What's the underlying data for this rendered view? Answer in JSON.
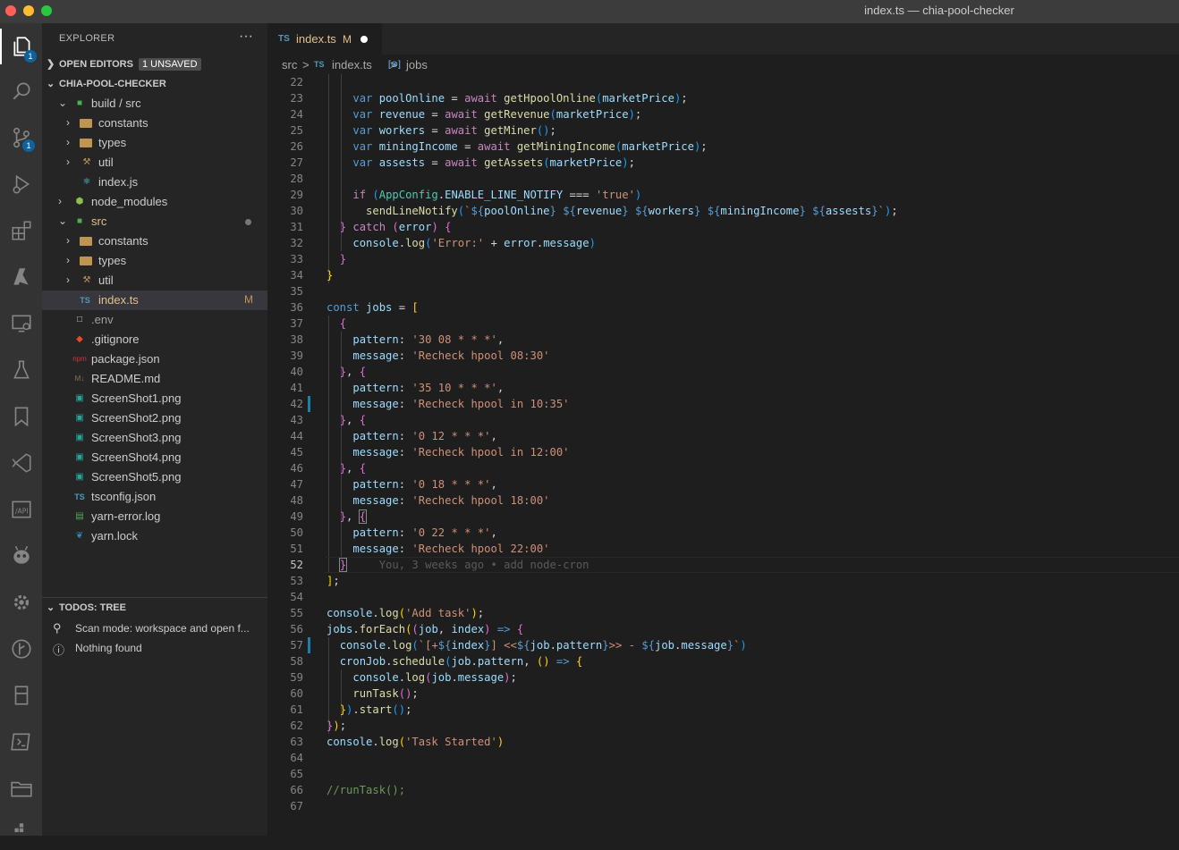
{
  "window": {
    "title": "index.ts — chia-pool-checker"
  },
  "activity": {
    "explorer_badge": "1",
    "scm_badge": "1"
  },
  "sidebar": {
    "title": "EXPLORER",
    "more": "···",
    "open_editors": {
      "label": "OPEN EDITORS",
      "badge": "1 UNSAVED"
    },
    "project": {
      "label": "CHIA-POOL-CHECKER"
    },
    "tree": [
      {
        "name": "build / src",
        "type": "folder-open",
        "depth": 1
      },
      {
        "name": "constants",
        "type": "folder",
        "depth": 2
      },
      {
        "name": "types",
        "type": "folder",
        "depth": 2
      },
      {
        "name": "util",
        "type": "folder",
        "depth": 2
      },
      {
        "name": "index.js",
        "type": "file",
        "depth": 2
      },
      {
        "name": "node_modules",
        "type": "folder",
        "depth": 1
      },
      {
        "name": "src",
        "type": "folder-open",
        "depth": 1
      },
      {
        "name": "constants",
        "type": "folder",
        "depth": 2
      },
      {
        "name": "types",
        "type": "folder",
        "depth": 2
      },
      {
        "name": "util",
        "type": "folder",
        "depth": 2
      },
      {
        "name": "index.ts",
        "type": "file",
        "depth": 2,
        "status": "M"
      },
      {
        "name": ".env",
        "type": "file",
        "depth": 1
      },
      {
        "name": ".gitignore",
        "type": "file",
        "depth": 1
      },
      {
        "name": "package.json",
        "type": "file",
        "depth": 1
      },
      {
        "name": "README.md",
        "type": "file",
        "depth": 1
      },
      {
        "name": "ScreenShot1.png",
        "type": "file",
        "depth": 1
      },
      {
        "name": "ScreenShot2.png",
        "type": "file",
        "depth": 1
      },
      {
        "name": "ScreenShot3.png",
        "type": "file",
        "depth": 1
      },
      {
        "name": "ScreenShot4.png",
        "type": "file",
        "depth": 1
      },
      {
        "name": "ScreenShot5.png",
        "type": "file",
        "depth": 1
      },
      {
        "name": "tsconfig.json",
        "type": "file",
        "depth": 1
      },
      {
        "name": "yarn-error.log",
        "type": "file",
        "depth": 1
      },
      {
        "name": "yarn.lock",
        "type": "file",
        "depth": 1
      }
    ],
    "todos": {
      "label": "TODOS: TREE",
      "scan": "Scan mode: workspace and open f...",
      "empty": "Nothing found"
    }
  },
  "editor": {
    "tab": {
      "icon": "TS",
      "name": "index.ts",
      "status": "M"
    },
    "breadcrumb": [
      "src",
      ">",
      "TS",
      "index.ts",
      ">",
      "[⊘]",
      "jobs"
    ],
    "blame": "You, 3 weeks ago • add node-cron",
    "line_numbers": [
      "22",
      "23",
      "24",
      "25",
      "26",
      "27",
      "28",
      "29",
      "30",
      "31",
      "32",
      "33",
      "34",
      "35",
      "36",
      "37",
      "38",
      "39",
      "40",
      "41",
      "42",
      "43",
      "44",
      "45",
      "46",
      "47",
      "48",
      "49",
      "50",
      "51",
      "52",
      "53",
      "54",
      "55",
      "56",
      "57",
      "58",
      "59",
      "60",
      "61",
      "62",
      "63",
      "64",
      "65",
      "66",
      "67"
    ]
  }
}
